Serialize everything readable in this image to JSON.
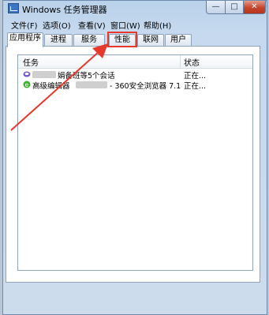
{
  "window": {
    "title": "Windows 任务管理器",
    "controls": {
      "minimize": "—",
      "maximize": "□",
      "close": "✕"
    }
  },
  "menu": [
    "文件(F)",
    "选项(O)",
    "查看(V)",
    "窗口(W)",
    "帮助(H)"
  ],
  "tabs": [
    {
      "label": "应用程序",
      "active": true
    },
    {
      "label": "进程",
      "active": false
    },
    {
      "label": "服务",
      "active": false
    },
    {
      "label": "性能",
      "active": false,
      "highlighted": true
    },
    {
      "label": "联网",
      "active": false
    },
    {
      "label": "用户",
      "active": false
    }
  ],
  "list": {
    "columns": [
      "任务",
      "状态"
    ],
    "rows": [
      {
        "task": "娟备班等5个会话",
        "status": "正在...",
        "icon": "chat-icon"
      },
      {
        "task": "高级编辑器",
        "task_suffix": "- 360安全浏览器 7.1",
        "status": "正在...",
        "icon": "browser-icon"
      }
    ]
  },
  "colors": {
    "highlight": "#e8372b",
    "arrow": "#e8372b"
  }
}
